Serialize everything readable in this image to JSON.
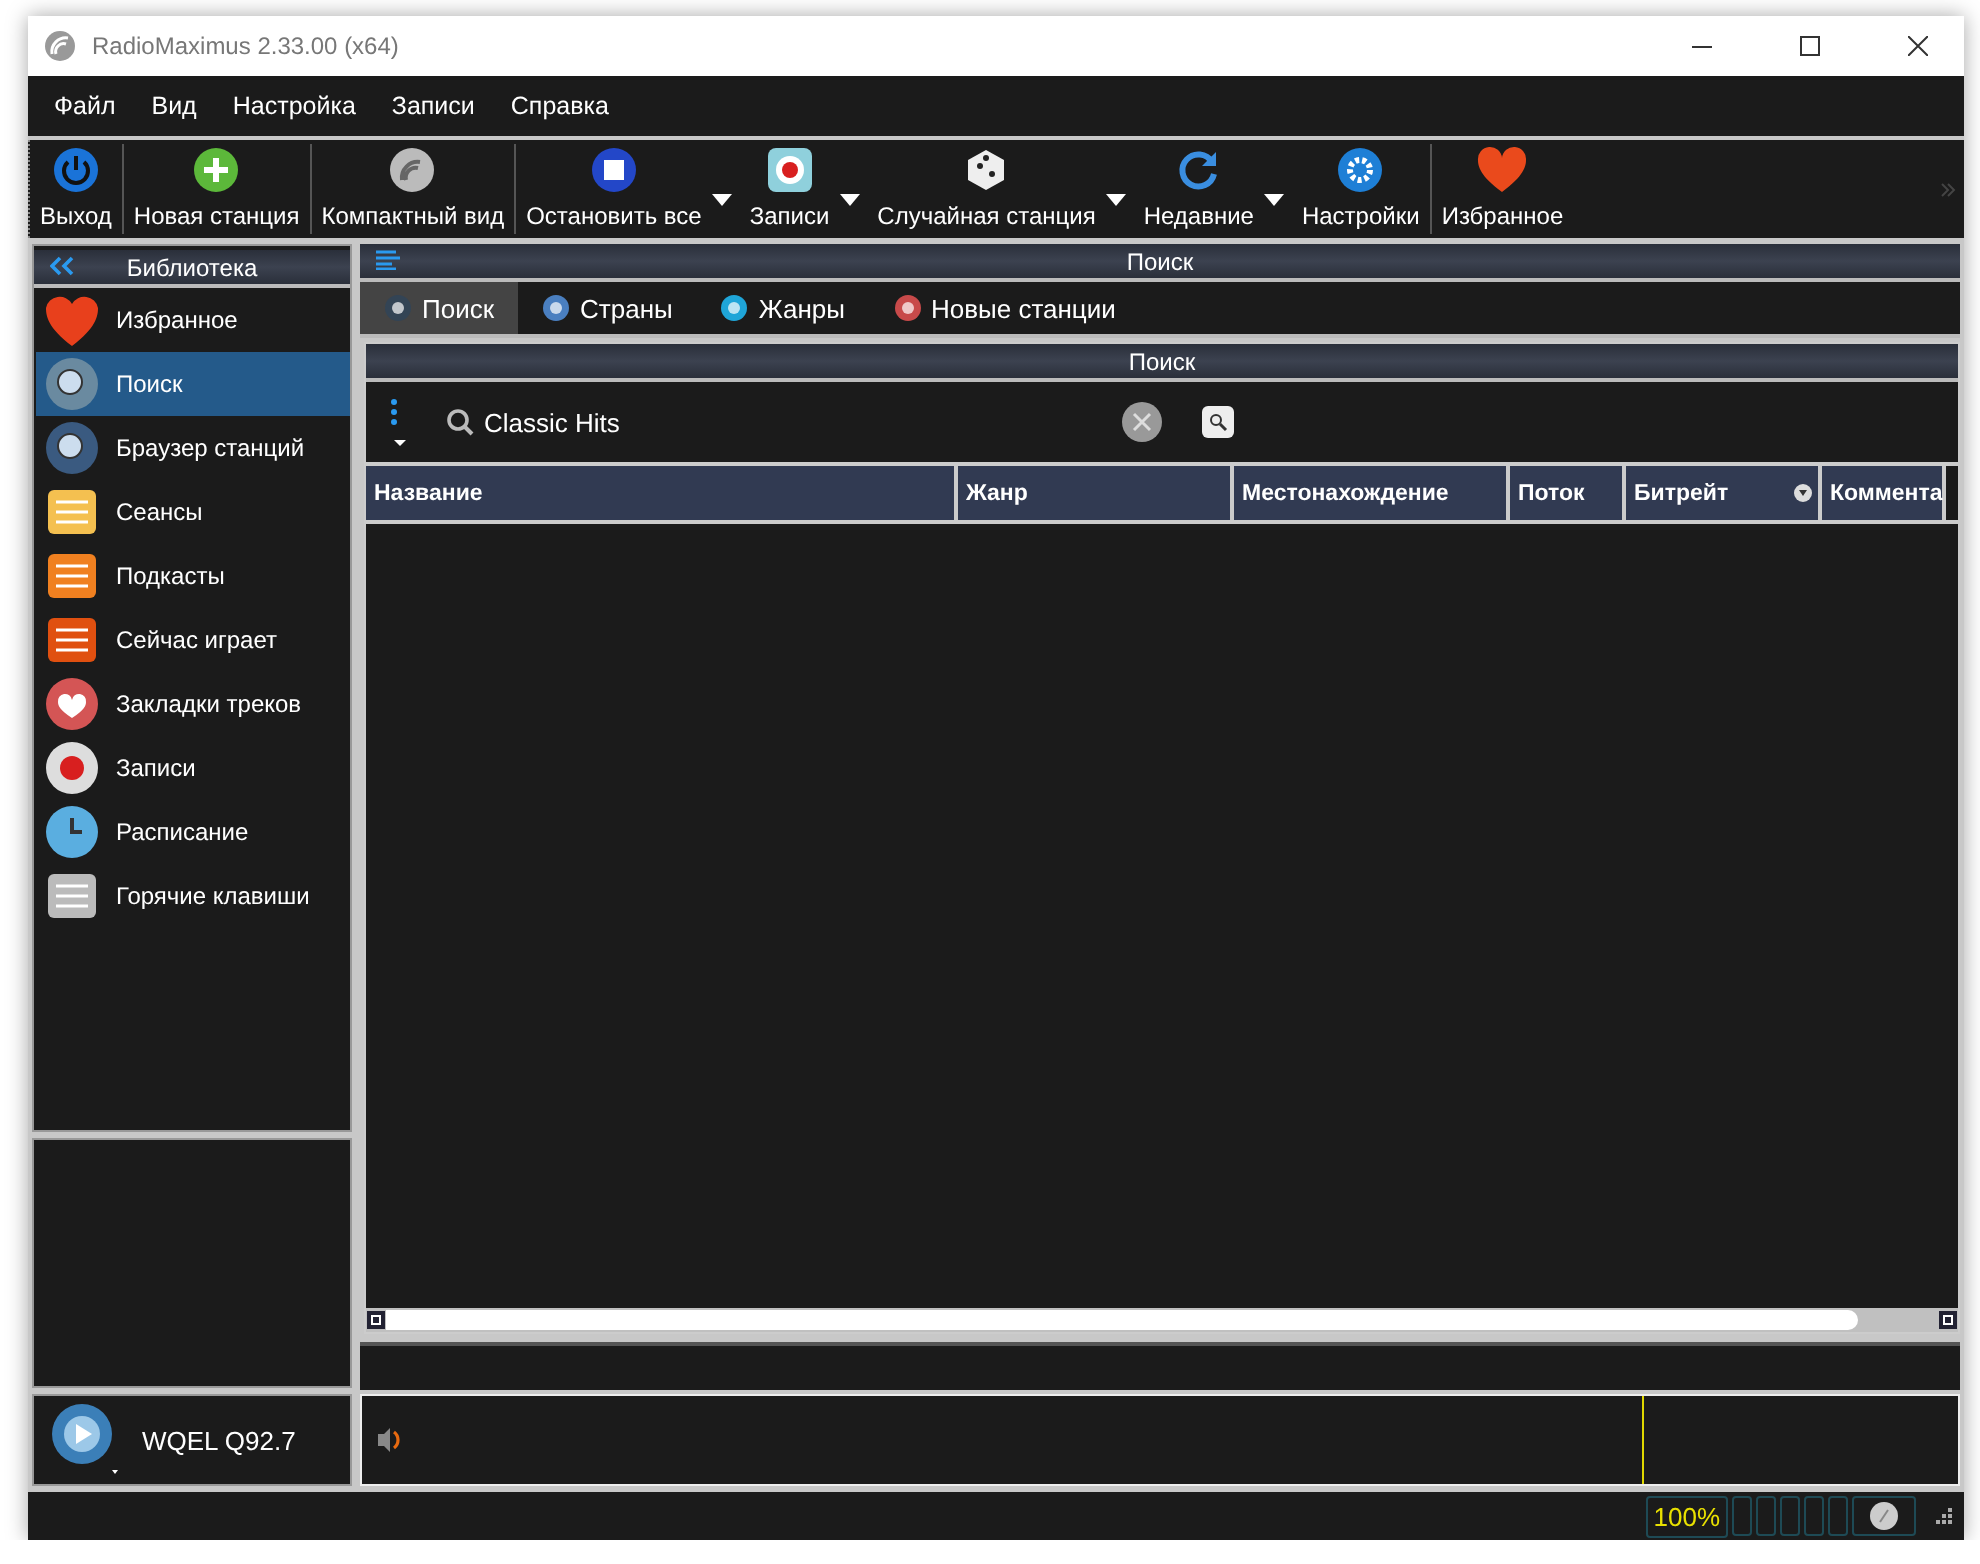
{
  "window": {
    "title": "RadioMaximus 2.33.00 (x64)"
  },
  "menu": [
    "Файл",
    "Вид",
    "Настройка",
    "Записи",
    "Справка"
  ],
  "toolbar": [
    {
      "label": "Выход",
      "dropdown": false
    },
    {
      "label": "Новая станция",
      "dropdown": false
    },
    {
      "label": "Компактный вид",
      "dropdown": false
    },
    {
      "label": "Остановить все",
      "dropdown": true
    },
    {
      "label": "Записи",
      "dropdown": true
    },
    {
      "label": "Случайная станция",
      "dropdown": true
    },
    {
      "label": "Недавние",
      "dropdown": true
    },
    {
      "label": "Настройки",
      "dropdown": false
    },
    {
      "label": "Избранное",
      "dropdown": false
    }
  ],
  "sidebar": {
    "title": "Библиотека",
    "items": [
      {
        "label": "Избранное",
        "selected": false
      },
      {
        "label": "Поиск",
        "selected": true
      },
      {
        "label": "Браузер станций",
        "selected": false
      },
      {
        "label": "Сеансы",
        "selected": false
      },
      {
        "label": "Подкасты",
        "selected": false
      },
      {
        "label": "Сейчас играет",
        "selected": false
      },
      {
        "label": "Закладки треков",
        "selected": false
      },
      {
        "label": "Записи",
        "selected": false
      },
      {
        "label": "Расписание",
        "selected": false
      },
      {
        "label": "Горячие клавиши",
        "selected": false
      }
    ]
  },
  "player": {
    "station": "WQEL Q92.7"
  },
  "main": {
    "title": "Поиск",
    "tabs": [
      {
        "label": "Поиск",
        "selected": true
      },
      {
        "label": "Страны",
        "selected": false
      },
      {
        "label": "Жанры",
        "selected": false
      },
      {
        "label": "Новые станции",
        "selected": false
      }
    ],
    "section_title": "Поиск",
    "search": {
      "value": "Classic Hits"
    },
    "table": {
      "columns": [
        "Название",
        "Жанр",
        "Местонахождение",
        "Поток",
        "Битрейт",
        "Коммента"
      ]
    }
  },
  "status_bar": {
    "zoom": "100%"
  }
}
